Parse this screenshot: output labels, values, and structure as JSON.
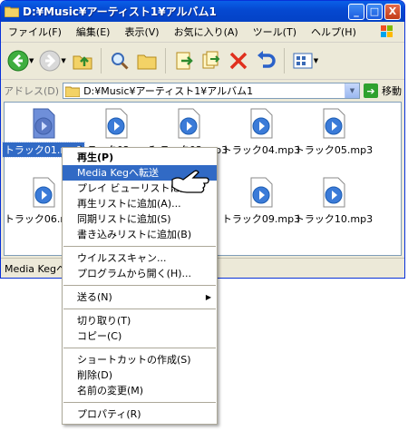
{
  "window": {
    "title": "D:¥Music¥アーティスト1¥アルバム1",
    "min_label": "_",
    "max_label": "□",
    "close_label": "X"
  },
  "menubar": [
    "ファイル(F)",
    "編集(E)",
    "表示(V)",
    "お気に入り(A)",
    "ツール(T)",
    "ヘルプ(H)"
  ],
  "address": {
    "label": "アドレス(D)",
    "value": "D:¥Music¥アーティスト1¥アルバム1",
    "go_label": "移動"
  },
  "files": [
    {
      "name": "トラック01.mp3",
      "selected": true
    },
    {
      "name": "トラック02.mp3",
      "selected": false
    },
    {
      "name": "トラック03.mp3",
      "selected": false
    },
    {
      "name": "トラック04.mp3",
      "selected": false
    },
    {
      "name": "トラック05.mp3",
      "selected": false
    },
    {
      "name": "トラック06.mp3",
      "selected": false
    },
    {
      "name": "トラック09.mp3",
      "selected": false
    },
    {
      "name": "トラック10.mp3",
      "selected": false
    }
  ],
  "status": {
    "text": "Media Kegへ"
  },
  "context_menu": {
    "items": [
      {
        "label": "再生(P)",
        "bold": true
      },
      {
        "label": "Media Kegへ転送",
        "highlighted": true
      },
      {
        "label": "プレイ ビューリストに追加"
      },
      {
        "label": "再生リストに追加(A)..."
      },
      {
        "label": "同期リストに追加(S)"
      },
      {
        "label": "書き込みリストに追加(B)"
      },
      {
        "separator": true
      },
      {
        "label": "ウイルススキャン..."
      },
      {
        "label": "プログラムから開く(H)..."
      },
      {
        "separator": true
      },
      {
        "label": "送る(N)",
        "submenu": true
      },
      {
        "separator": true
      },
      {
        "label": "切り取り(T)"
      },
      {
        "label": "コピー(C)"
      },
      {
        "separator": true
      },
      {
        "label": "ショートカットの作成(S)"
      },
      {
        "label": "削除(D)"
      },
      {
        "label": "名前の変更(M)"
      },
      {
        "separator": true
      },
      {
        "label": "プロパティ(R)"
      }
    ]
  },
  "colors": {
    "selection": "#316ac5",
    "titlebar": "#0548d0"
  }
}
